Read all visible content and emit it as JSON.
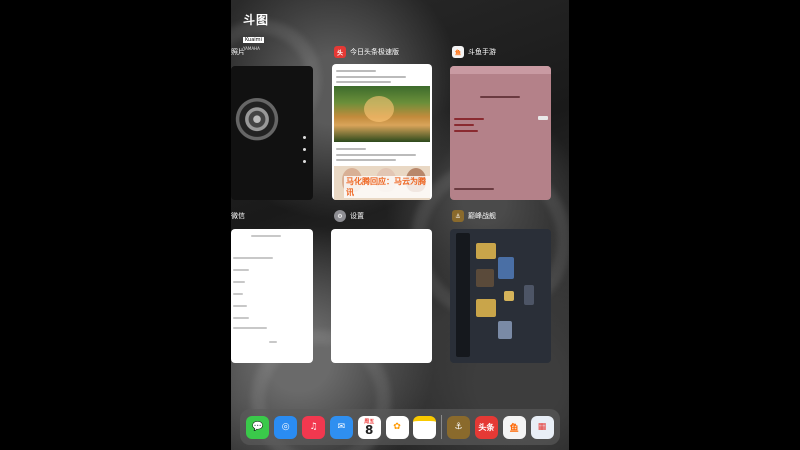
{
  "watermark": {
    "logo": "斗图",
    "tag": "Kuaimi",
    "sub": "YAMAHA"
  },
  "cards": [
    {
      "id": "photos",
      "title": "照片"
    },
    {
      "id": "toutiao",
      "title": "今日头条极速版",
      "icon_text": "头条"
    },
    {
      "id": "douyu",
      "title": "斗鱼手游"
    },
    {
      "id": "wechat",
      "title": "微信"
    },
    {
      "id": "settings",
      "title": "设置"
    },
    {
      "id": "game",
      "title": "巅峰战舰"
    }
  ],
  "toutiao_caption": "马化腾回应：马云为腾讯",
  "dock": {
    "apps": [
      {
        "name": "messages",
        "color": "#3ac94a"
      },
      {
        "name": "safari",
        "color": "#2a8cf2"
      },
      {
        "name": "music",
        "color": "#f2384f"
      },
      {
        "name": "mail",
        "color": "#2f8ff0"
      },
      {
        "name": "calendar",
        "color": "#ffffff",
        "day_label": "周五",
        "day_number": "8"
      },
      {
        "name": "photos",
        "color": "#ffffff"
      },
      {
        "name": "notes",
        "color": "#ffffff"
      }
    ],
    "recent": [
      {
        "name": "game",
        "color": "#8a6a2c"
      },
      {
        "name": "toutiao",
        "color": "#e53935",
        "label": "头条"
      },
      {
        "name": "douyu",
        "color": "#f4f4f4"
      },
      {
        "name": "multi",
        "color": "#e8eef6"
      }
    ]
  },
  "colors": {
    "accent": "#ff3b30"
  }
}
